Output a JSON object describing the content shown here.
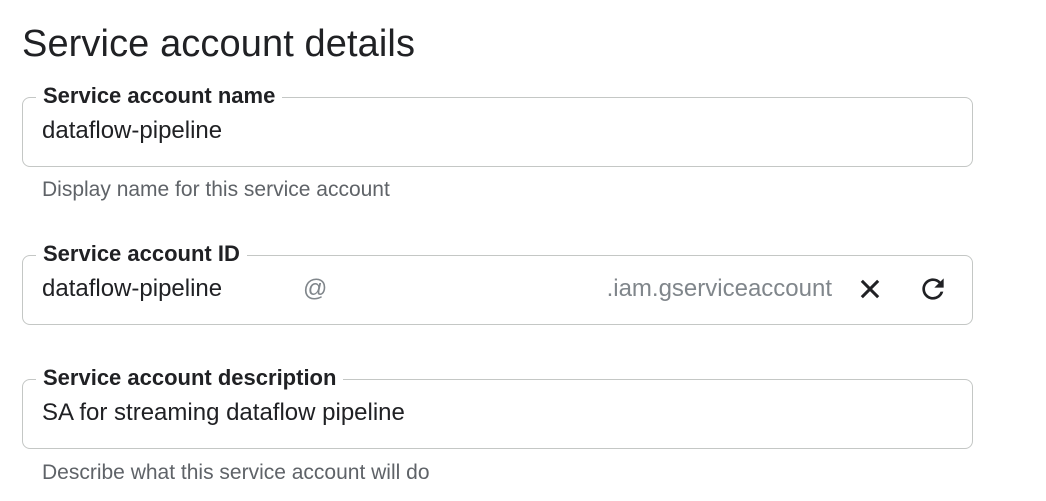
{
  "section": {
    "title": "Service account details"
  },
  "fields": {
    "name": {
      "label": "Service account name",
      "value": "dataflow-pipeline",
      "hint": "Display name for this service account"
    },
    "id": {
      "label": "Service account ID",
      "value": "dataflow-pipeline",
      "at": "@",
      "suffix": ".iam.gserviceaccount",
      "clear_icon": "close-icon",
      "refresh_icon": "refresh-icon"
    },
    "description": {
      "label": "Service account description",
      "value": "SA for streaming dataflow pipeline",
      "hint": "Describe what this service account will do"
    }
  },
  "colors": {
    "text": "#202124",
    "hint": "#5f6368",
    "border": "#c4c7c5",
    "muted": "#80868b"
  }
}
